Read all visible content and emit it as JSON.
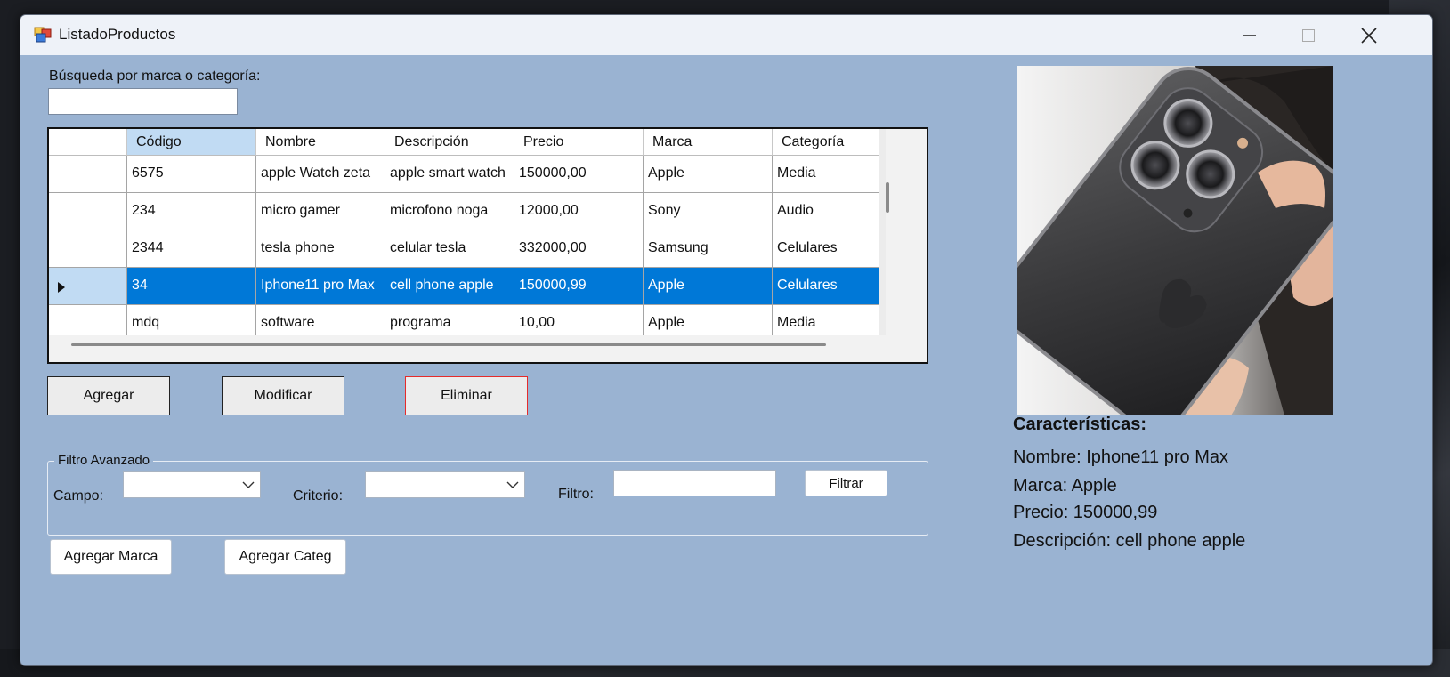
{
  "window": {
    "title": "ListadoProductos"
  },
  "search": {
    "label": "Búsqueda por marca o categoría:",
    "value": ""
  },
  "grid": {
    "columns": [
      "Código",
      "Nombre",
      "Descripción",
      "Precio",
      "Marca",
      "Categoría"
    ],
    "rows": [
      [
        "6575",
        "apple Watch zeta",
        "apple smart watch",
        "150000,00",
        "Apple",
        "Media"
      ],
      [
        "234",
        "micro gamer",
        "microfono noga",
        "12000,00",
        "Sony",
        "Audio"
      ],
      [
        "2344",
        "tesla phone",
        "celular tesla",
        "332000,00",
        "Samsung",
        "Celulares"
      ],
      [
        "34",
        "Iphone11 pro Max",
        "cell phone apple",
        "150000,99",
        "Apple",
        "Celulares"
      ],
      [
        "mdq",
        "software",
        "programa",
        "10,00",
        "Apple",
        "Media"
      ]
    ],
    "selected_row": 3
  },
  "buttons": {
    "add": "Agregar",
    "modify": "Modificar",
    "delete": "Eliminar",
    "add_brand": "Agregar Marca",
    "add_category": "Agregar Categ"
  },
  "filter": {
    "group_title": "Filtro Avanzado",
    "field_label": "Campo:",
    "field_value": "",
    "criteria_label": "Criterio:",
    "criteria_value": "",
    "filter_label": "Filtro:",
    "filter_value": "",
    "filter_button": "Filtrar"
  },
  "details": {
    "heading": "Características:",
    "name": "Nombre: Iphone11 pro Max",
    "brand": "Marca: Apple",
    "price": "Precio: 150000,99",
    "description": "Descripción: cell phone apple"
  },
  "colors": {
    "form_bg": "#9ab3d2",
    "selection": "#0078d7",
    "delete_border": "#e52b2b"
  },
  "icons": {
    "app": "form-icon",
    "minimize": "minimize-icon",
    "maximize": "maximize-icon",
    "close": "close-icon",
    "row_pointer": "triangle-right-icon",
    "dropdown": "chevron-down-icon"
  }
}
